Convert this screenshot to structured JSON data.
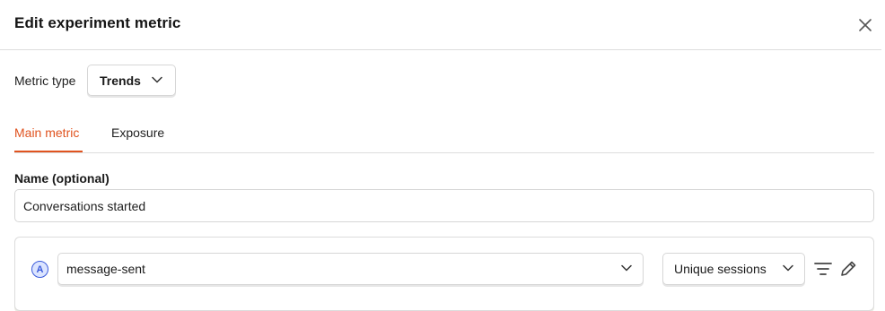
{
  "dialog": {
    "title": "Edit experiment metric",
    "close_icon": "close-icon"
  },
  "metric_type": {
    "label": "Metric type",
    "selected": "Trends",
    "icon": "chevron-down-icon"
  },
  "tabs": [
    {
      "label": "Main metric",
      "active": true
    },
    {
      "label": "Exposure",
      "active": false
    }
  ],
  "colors": {
    "accent": "#e0531f",
    "series_badge": "#3b5bdb"
  },
  "name_field": {
    "label": "Name (optional)",
    "value": "Conversations started"
  },
  "series": {
    "badge": "A",
    "event": "message-sent",
    "math": "Unique sessions",
    "icons": [
      "filter-icon",
      "pencil-icon"
    ]
  }
}
